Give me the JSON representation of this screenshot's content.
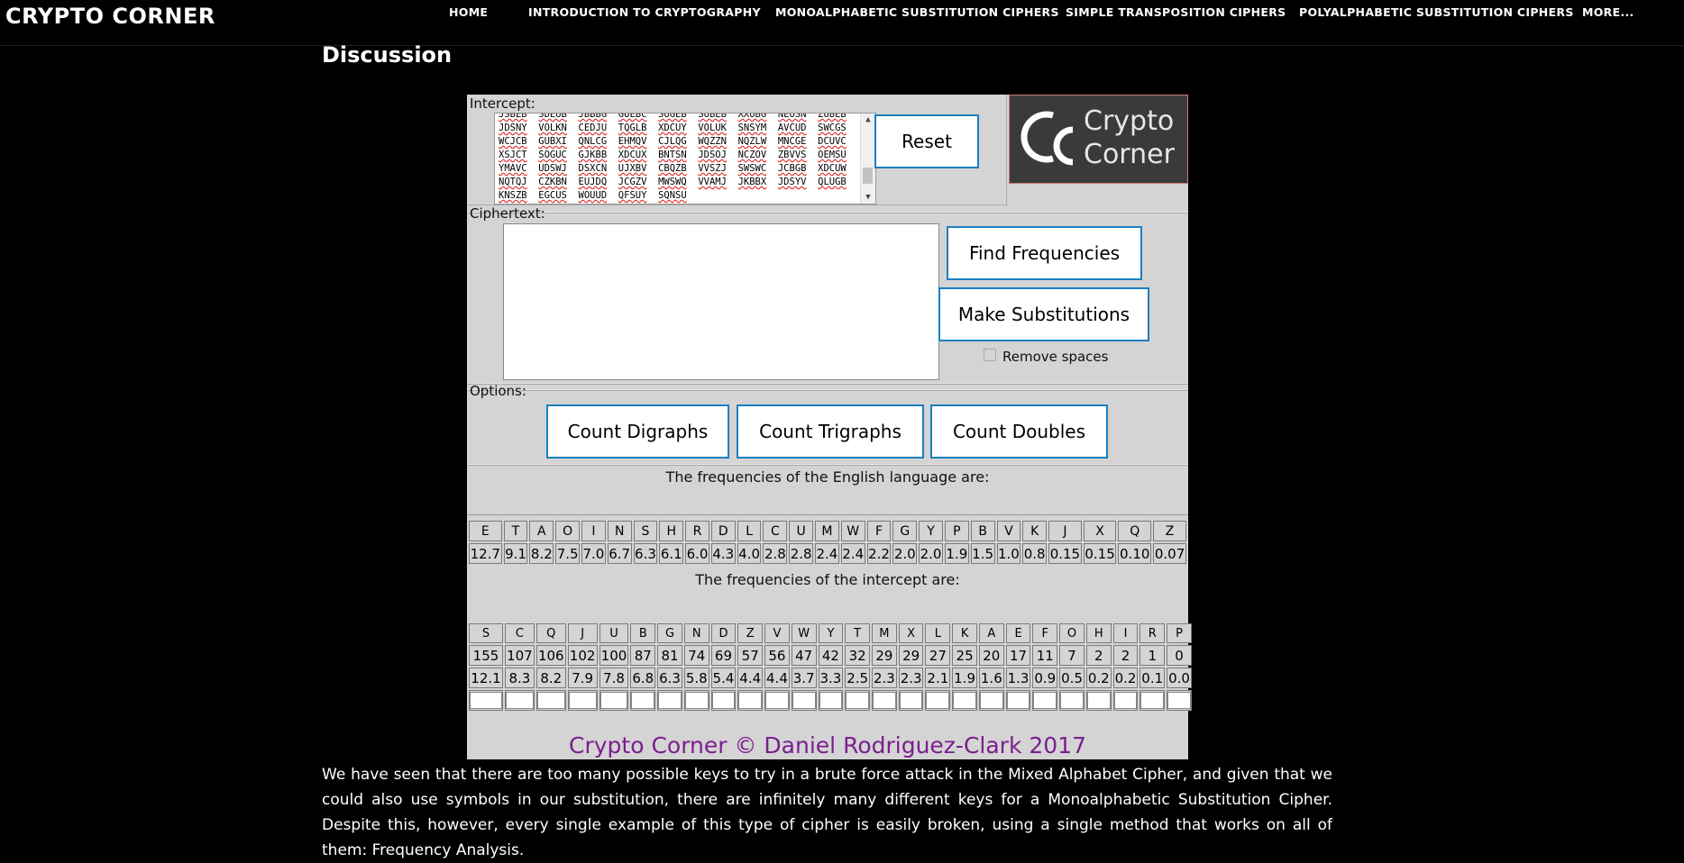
{
  "site_title": "CRYPTO CORNER",
  "nav": [
    {
      "label": "HOME"
    },
    {
      "label": "INTRODUCTION TO CRYPTOGRAPHY"
    },
    {
      "label": "MONOALPHABETIC SUBSTITUTION CIPHERS"
    },
    {
      "label": "SIMPLE TRANSPOSITION CIPHERS"
    },
    {
      "label": "POLYALPHABETIC SUBSTITUTION CIPHERS"
    },
    {
      "label": "MORE..."
    }
  ],
  "page_heading": "Discussion",
  "tool": {
    "intercept_label": "Intercept:",
    "intercept_lines": [
      [
        "JSBEB",
        "SDEUB",
        "JBBBG",
        "GUEBC",
        "SUGEB",
        "SUBEB",
        "XXUBG",
        "NEOSN",
        "ZUBEB"
      ],
      [
        "JDSNY",
        "VOLKN",
        "CEDJU",
        "TQGLB",
        "XDCUY",
        "VOLUK",
        "SNSYM",
        "AVCUD",
        "SWCGS"
      ],
      [
        "WCJCB",
        "GUBXI",
        "QNLCG",
        "EHMQV",
        "CJLQG",
        "WQZZN",
        "NQZLW",
        "MNCGE",
        "DCUVC"
      ],
      [
        "XSJCT",
        "SOGUC",
        "GJKBB",
        "XDCUX",
        "BNTSN",
        "JDSOJ",
        "NCZOV",
        "ZBVVS",
        "OEMSU"
      ],
      [
        "YMAVC",
        "UDSWJ",
        "DSXCN",
        "UJXBV",
        "CBQZB",
        "VVSZJ",
        "SWSWC",
        "JCBGB",
        "XDCUW"
      ],
      [
        "NQTQJ",
        "CZKBN",
        "EUJDQ",
        "JCGZV",
        "MWSWQ",
        "VVAMJ",
        "JKBBX",
        "JDSYV",
        "QLUGB"
      ],
      [
        "KNSZB",
        "EGCUS",
        "WOUUD",
        "QFSUY",
        "SQNSU"
      ]
    ],
    "reset_label": "Reset",
    "logo_line1": "Crypto",
    "logo_line2": "Corner",
    "ciphertext_label": "Ciphertext:",
    "ciphertext_value": "",
    "find_frequencies_label": "Find Frequencies",
    "make_substitutions_label": "Make Substitutions",
    "remove_spaces_label": "Remove spaces",
    "options_label": "Options:",
    "count_digraphs_label": "Count Digraphs",
    "count_trigraphs_label": "Count Trigraphs",
    "count_doubles_label": "Count Doubles",
    "english_freq_title": "The frequencies of the English language are:",
    "english_letters": [
      "E",
      "T",
      "A",
      "O",
      "I",
      "N",
      "S",
      "H",
      "R",
      "D",
      "L",
      "C",
      "U",
      "M",
      "W",
      "F",
      "G",
      "Y",
      "P",
      "B",
      "V",
      "K",
      "J",
      "X",
      "Q",
      "Z"
    ],
    "english_values": [
      "12.7",
      "9.1",
      "8.2",
      "7.5",
      "7.0",
      "6.7",
      "6.3",
      "6.1",
      "6.0",
      "4.3",
      "4.0",
      "2.8",
      "2.8",
      "2.4",
      "2.4",
      "2.2",
      "2.0",
      "2.0",
      "1.9",
      "1.5",
      "1.0",
      "0.8",
      "0.15",
      "0.15",
      "0.10",
      "0.07"
    ],
    "intercept_freq_title": "The frequencies of the intercept are:",
    "intercept_letters": [
      "S",
      "C",
      "Q",
      "J",
      "U",
      "B",
      "G",
      "N",
      "D",
      "Z",
      "V",
      "W",
      "Y",
      "T",
      "M",
      "X",
      "L",
      "K",
      "A",
      "E",
      "F",
      "O",
      "H",
      "I",
      "R",
      "P"
    ],
    "intercept_counts": [
      "155",
      "107",
      "106",
      "102",
      "100",
      "87",
      "81",
      "74",
      "69",
      "57",
      "56",
      "47",
      "42",
      "32",
      "29",
      "29",
      "27",
      "25",
      "20",
      "17",
      "11",
      "7",
      "2",
      "2",
      "1",
      "0"
    ],
    "intercept_percents": [
      "12.1",
      "8.3",
      "8.2",
      "7.9",
      "7.8",
      "6.8",
      "6.3",
      "5.8",
      "5.4",
      "4.4",
      "4.4",
      "3.7",
      "3.3",
      "2.5",
      "2.3",
      "2.3",
      "2.1",
      "1.9",
      "1.6",
      "1.3",
      "0.9",
      "0.5",
      "0.2",
      "0.2",
      "0.1",
      "0.0"
    ],
    "copyright": "Crypto Corner © Daniel Rodriguez-Clark 2017"
  },
  "body_text": "We have seen that there are too many possible keys to try in a brute force attack in the Mixed Alphabet Cipher, and given that we could also use symbols in our substitution, there are infinitely many different keys for a Monoalphabetic Substitution Cipher. Despite this, however, every single example of this type of cipher is easily broken, using a single method that works on all of them: Frequency Analysis."
}
